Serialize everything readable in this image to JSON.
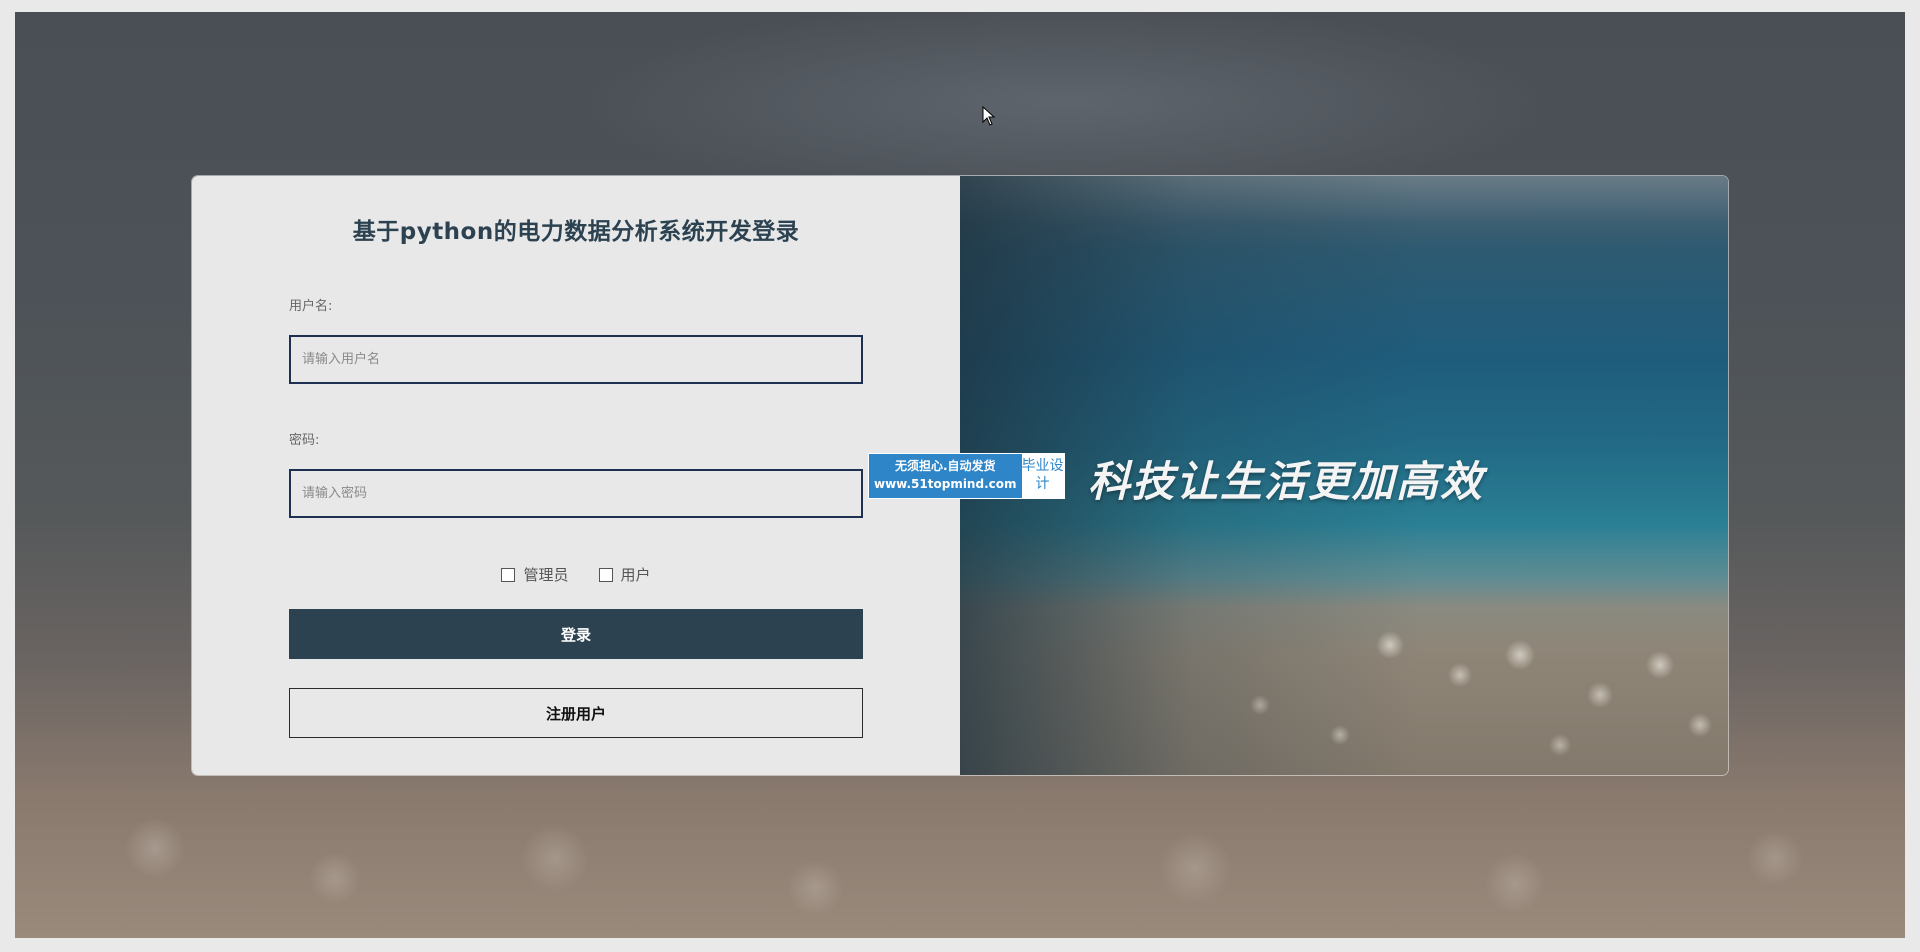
{
  "login": {
    "title": "基于python的电力数据分析系统开发登录",
    "username_label": "用户名:",
    "username_placeholder": "请输入用户名",
    "password_label": "密码:",
    "password_placeholder": "请输入密码",
    "roles": [
      "管理员",
      "用户"
    ],
    "login_button": "登录",
    "register_button": "注册用户"
  },
  "banner": {
    "slogan": "科技让生活更加高效"
  },
  "watermark": {
    "line1": "无须担心.自动发货",
    "line2": "www.51topmind.com",
    "side": "毕业设计"
  },
  "colors": {
    "primary": "#2c4251",
    "input_border": "#1f2f52",
    "form_bg": "#e8e8e8",
    "watermark_blue": "#2e86c9"
  }
}
